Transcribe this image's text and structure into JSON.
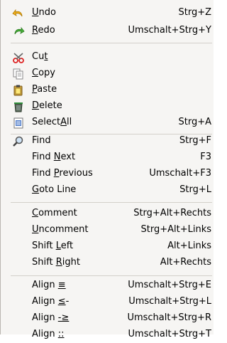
{
  "menu": {
    "items": [
      {
        "before": "",
        "mn": "U",
        "after": "ndo",
        "shortcut": "Strg+Z",
        "icon": "undo-icon"
      },
      {
        "before": "",
        "mn": "R",
        "after": "edo",
        "shortcut": "Umschalt+Strg+Y",
        "icon": "redo-icon"
      },
      {
        "before": "Cu",
        "mn": "t",
        "after": "",
        "shortcut": "",
        "icon": "cut-icon"
      },
      {
        "before": "",
        "mn": "C",
        "after": "opy",
        "shortcut": "",
        "icon": "copy-icon"
      },
      {
        "before": "",
        "mn": "P",
        "after": "aste",
        "shortcut": "",
        "icon": "paste-icon"
      },
      {
        "before": "",
        "mn": "D",
        "after": "elete",
        "shortcut": "",
        "icon": "delete-icon"
      },
      {
        "before": "Select",
        "mn": "A",
        "after": "ll",
        "shortcut": "Strg+A",
        "icon": "select-all-icon"
      },
      {
        "before": "Find",
        "mn": "",
        "after": "",
        "shortcut": "Strg+F",
        "icon": "find-icon"
      },
      {
        "before": "Find ",
        "mn": "N",
        "after": "ext",
        "shortcut": "F3",
        "icon": ""
      },
      {
        "before": "Find ",
        "mn": "P",
        "after": "revious",
        "shortcut": "Umschalt+F3",
        "icon": ""
      },
      {
        "before": "",
        "mn": "G",
        "after": "oto Line",
        "shortcut": "Strg+L",
        "icon": ""
      },
      {
        "before": "",
        "mn": "C",
        "after": "omment",
        "shortcut": "Strg+Alt+Rechts",
        "icon": ""
      },
      {
        "before": "",
        "mn": "U",
        "after": "ncomment",
        "shortcut": "Strg+Alt+Links",
        "icon": ""
      },
      {
        "before": "Shift ",
        "mn": "L",
        "after": "eft",
        "shortcut": "Alt+Links",
        "icon": ""
      },
      {
        "before": "Shift ",
        "mn": "R",
        "after": "ight",
        "shortcut": "Alt+Rechts",
        "icon": ""
      },
      {
        "before": "Align ",
        "mn": "≡",
        "after": "",
        "shortcut": "Umschalt+Strg+E",
        "icon": ""
      },
      {
        "before": "Align ",
        "mn": "≤",
        "after": "-",
        "shortcut": "Umschalt+Strg+L",
        "icon": ""
      },
      {
        "before": "Align ",
        "mn": "-≥",
        "after": "",
        "shortcut": "Umschalt+Strg+R",
        "icon": ""
      },
      {
        "before": "Align ",
        "mn": "::",
        "after": "",
        "shortcut": "Umschalt+Strg+T",
        "icon": ""
      }
    ]
  }
}
